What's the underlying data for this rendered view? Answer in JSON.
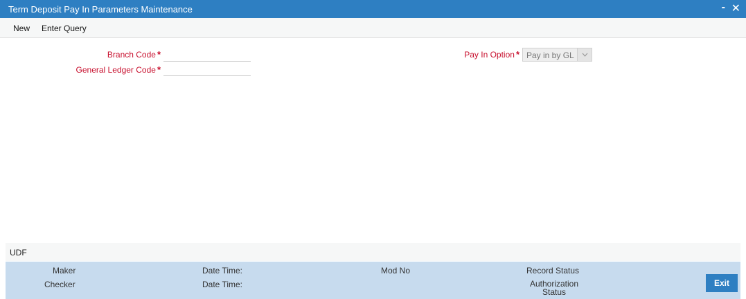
{
  "window": {
    "title": "Term Deposit Pay In Parameters Maintenance",
    "minimize_icon": "-",
    "close_icon": "✕"
  },
  "toolbar": {
    "new_label": "New",
    "enter_query_label": "Enter Query"
  },
  "form": {
    "branch_code": {
      "label": "Branch Code",
      "required": "*",
      "value": ""
    },
    "gl_code": {
      "label": "General Ledger Code",
      "required": "*",
      "value": ""
    },
    "pay_in_option": {
      "label": "Pay In Option",
      "required": "*",
      "selected": "Pay in by GL"
    }
  },
  "udf": {
    "label": "UDF"
  },
  "footer": {
    "maker_label": "Maker",
    "checker_label": "Checker",
    "maker_datetime_label": "Date Time:",
    "checker_datetime_label": "Date Time:",
    "mod_no_label": "Mod No",
    "record_status_label": "Record Status",
    "authorization_status_label": "Authorization Status",
    "exit_label": "Exit"
  },
  "colors": {
    "titlebar": "#2e7fc2",
    "required_label": "#c8102e",
    "footer_bg": "#c7dbee",
    "exit_button": "#2e7fc2"
  }
}
